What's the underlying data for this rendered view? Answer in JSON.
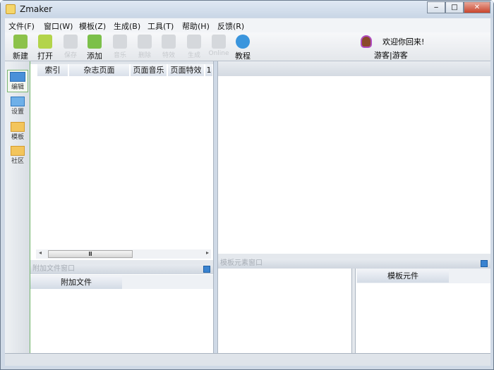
{
  "window": {
    "title": "Zmaker",
    "minimize": "‒",
    "maximize": "□",
    "close": "✕"
  },
  "menu": [
    "文件(F)",
    "窗口(W)",
    "模板(Z)",
    "生成(B)",
    "工具(T)",
    "帮助(H)",
    "反馈(R)"
  ],
  "toolbar": [
    {
      "label": "新建",
      "icon": "new-icon",
      "enabled": true,
      "color": "#8cc24a"
    },
    {
      "label": "打开",
      "icon": "open-folder-icon",
      "enabled": true,
      "color": "#b3d44a"
    },
    {
      "label": "保存",
      "icon": "save-icon",
      "enabled": false
    },
    {
      "label": "添加",
      "icon": "add-icon",
      "enabled": true,
      "color": "#7cc04a"
    },
    {
      "label": "音乐",
      "icon": "music-icon",
      "enabled": false
    },
    {
      "label": "删除",
      "icon": "delete-icon",
      "enabled": false
    },
    {
      "label": "特效",
      "icon": "effect-icon",
      "enabled": false
    },
    {
      "label": "生成",
      "icon": "generate-icon",
      "enabled": false
    },
    {
      "label": "Online",
      "icon": "online-icon",
      "enabled": false
    },
    {
      "label": "教程",
      "icon": "help-icon",
      "enabled": true,
      "color": "#3a95dd"
    }
  ],
  "user": {
    "welcome": "欢迎你回来!",
    "name": "游客|游客"
  },
  "sidebar": [
    {
      "label": "编辑",
      "icon": "edit-icon"
    },
    {
      "label": "设置",
      "icon": "settings-icon"
    },
    {
      "label": "模板",
      "icon": "template-icon"
    },
    {
      "label": "社区",
      "icon": "community-icon"
    }
  ],
  "grid": {
    "columns": [
      "索引",
      "杂志页面",
      "页面音乐",
      "页面特效",
      "1"
    ]
  },
  "scroll": {
    "thumb": "Ⅲ"
  },
  "attach": {
    "header": "附加文件窗口",
    "tab": "附加文件"
  },
  "template": {
    "header": "模板元素窗口",
    "tab": "模板元件"
  }
}
